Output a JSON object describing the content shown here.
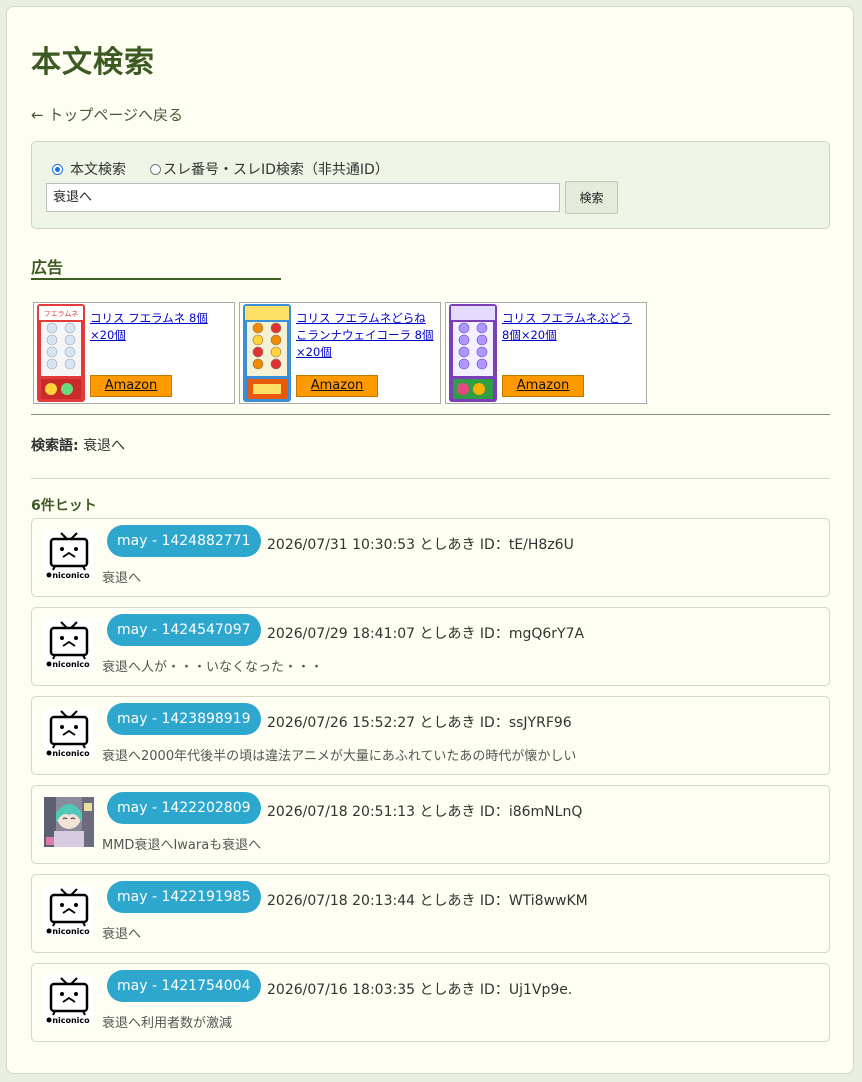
{
  "page": {
    "title": "本文検索",
    "back_link": "← トップページへ戻る"
  },
  "search": {
    "mode_text": "本文検索",
    "mode_thread": "スレ番号・スレID検索（非共通ID）",
    "selected_mode": "本文検索",
    "query_value": "衰退へ",
    "button_label": "検索"
  },
  "ads": {
    "heading": "広告",
    "items": [
      {
        "name": "コリス フエラムネ 8個×20個",
        "button": "Amazon"
      },
      {
        "name": "コリス フエラムネどらねこランナウェイコーラ 8個×20個",
        "button": "Amazon"
      },
      {
        "name": "コリス フエラムネぶどう 8個×20個",
        "button": "Amazon"
      }
    ]
  },
  "query_summary": {
    "label": "検索語:",
    "value": "衰退へ"
  },
  "results_header": "6件ヒット",
  "results": [
    {
      "avatar": "niconico-tv-icon",
      "avatar_label": "niconico",
      "thread": "may - 1424882771",
      "meta": "2026/07/31 10:30:53 としあき ID：tE/H8z6U",
      "text": "衰退へ"
    },
    {
      "avatar": "niconico-tv-icon",
      "avatar_label": "niconico",
      "thread": "may - 1424547097",
      "meta": "2026/07/29 18:41:07 としあき ID：mgQ6rY7A",
      "text": "衰退へ人が・・・いなくなった・・・"
    },
    {
      "avatar": "niconico-tv-icon",
      "avatar_label": "niconico",
      "thread": "may - 1423898919",
      "meta": "2026/07/26 15:52:27 としあき ID：ssJYRF96",
      "text": "衰退へ2000年代後半の頃は違法アニメが大量にあふれていたあの時代が懐かしい"
    },
    {
      "avatar": "thread-thumbnail",
      "avatar_label": "",
      "thread": "may - 1422202809",
      "meta": "2026/07/18 20:51:13 としあき ID：i86mNLnQ",
      "text": "MMD衰退へIwaraも衰退へ"
    },
    {
      "avatar": "niconico-tv-icon",
      "avatar_label": "niconico",
      "thread": "may - 1422191985",
      "meta": "2026/07/18 20:13:44 としあき ID：WTi8wwKM",
      "text": "衰退へ"
    },
    {
      "avatar": "niconico-tv-icon",
      "avatar_label": "niconico",
      "thread": "may - 1421754004",
      "meta": "2026/07/16 18:03:35 としあき ID：Uj1Vp9e.",
      "text": "衰退へ利用者数が激減"
    }
  ],
  "colors": {
    "heading_green": "#3d5a23",
    "pill_blue": "#2ea7cf",
    "amazon_orange": "#ff9900",
    "page_bg": "#fefef2"
  }
}
